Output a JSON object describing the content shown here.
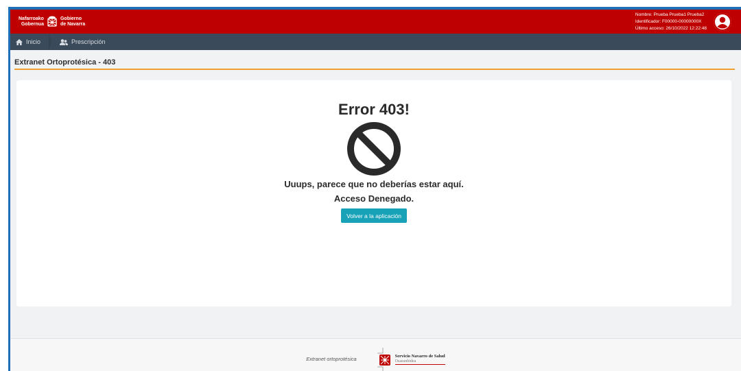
{
  "header": {
    "brand_left_line1": "Nafarroako",
    "brand_left_line2": "Gobernua",
    "brand_right_line1": "Gobierno",
    "brand_right_line2": "de Navarra",
    "user_name": "Nombre: Prueba Prueba1 Prueba2",
    "user_id": "Identificador: F00000-00000000X",
    "last_access": "Último acceso: 26/10/2022 12:22:48",
    "avatar_icon": "user-circle-icon"
  },
  "nav": {
    "items": [
      {
        "label": "Inicio",
        "icon": "home-icon"
      },
      {
        "label": "Prescripción",
        "icon": "users-icon"
      }
    ]
  },
  "page": {
    "title": "Extranet Ortoprotésica - 403"
  },
  "error": {
    "title": "Error 403!",
    "icon": "ban-icon",
    "message": "Uuups, parece que no deberías estar aquí.",
    "denied": "Acceso Denegado.",
    "button_label": "Volver a la aplicación"
  },
  "footer": {
    "text": "Extranet ortoprotésica",
    "logo_title": "Servicio Navarro de Salud",
    "logo_subtitle": "Osasunbidea"
  },
  "colors": {
    "header_bg": "#bf0000",
    "nav_bg": "#3b4a5a",
    "accent_underline": "#f0a030",
    "button_bg": "#17a2b8",
    "frame": "#1e6fb8"
  }
}
